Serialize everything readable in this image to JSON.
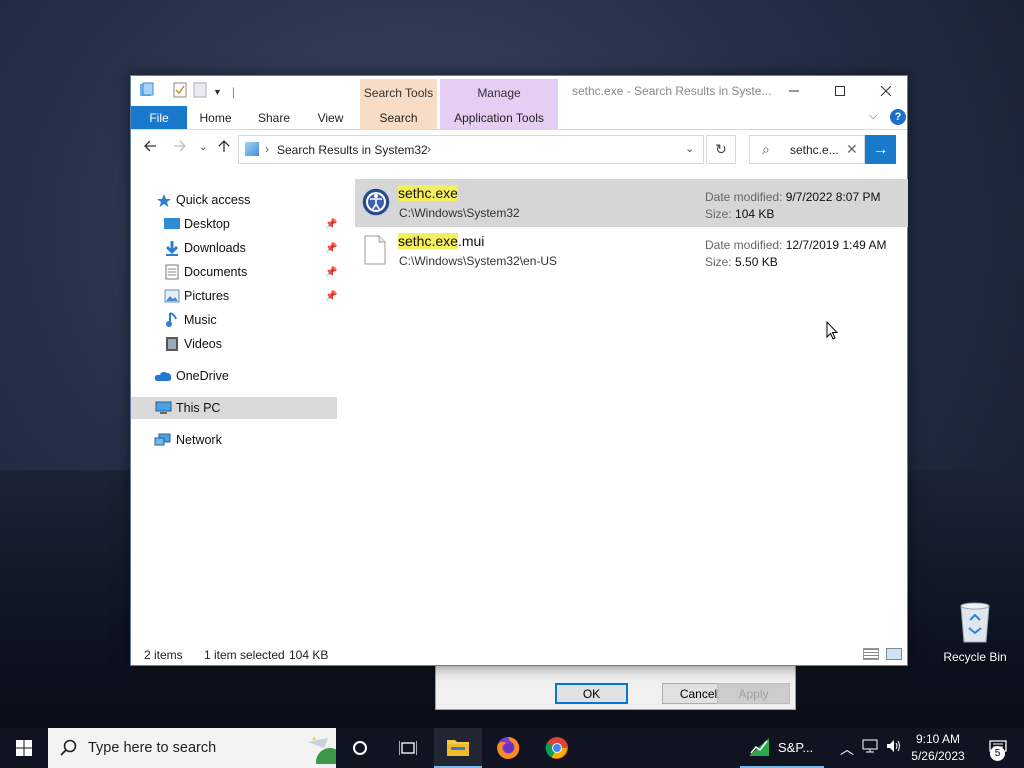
{
  "window": {
    "title": "sethc.exe - Search Results in Syste...",
    "qat_separator": "|",
    "contextual": {
      "search_tools": "Search Tools",
      "manage": "Manage"
    },
    "tabs": {
      "file": "File",
      "home": "Home",
      "share": "Share",
      "view": "View",
      "search": "Search",
      "app_tools": "Application Tools"
    },
    "help": "?"
  },
  "address": {
    "path": "Search Results in System32",
    "separator": "›"
  },
  "search": {
    "query": "sethc.e..."
  },
  "nav": {
    "items": [
      {
        "label": "Quick access",
        "icon": "star-icon"
      },
      {
        "label": "Desktop",
        "icon": "desktop-icon",
        "pinned": true
      },
      {
        "label": "Downloads",
        "icon": "download-icon",
        "pinned": true
      },
      {
        "label": "Documents",
        "icon": "documents-icon",
        "pinned": true
      },
      {
        "label": "Pictures",
        "icon": "pictures-icon",
        "pinned": true
      },
      {
        "label": "Music",
        "icon": "music-icon"
      },
      {
        "label": "Videos",
        "icon": "videos-icon"
      },
      {
        "label": "OneDrive",
        "icon": "cloud-icon"
      },
      {
        "label": "This PC",
        "icon": "computer-icon",
        "selected": true
      },
      {
        "label": "Network",
        "icon": "network-icon"
      }
    ]
  },
  "results": [
    {
      "name_highlight": "sethc.exe",
      "name_rest": "",
      "path": "C:\\Windows\\System32",
      "date_label": "Date modified:",
      "date": "9/7/2022 8:07 PM",
      "size_label": "Size:",
      "size": "104 KB",
      "selected": true
    },
    {
      "name_highlight": "sethc.exe",
      "name_rest": ".mui",
      "path": "C:\\Windows\\System32\\en-US",
      "date_label": "Date modified:",
      "date": "12/7/2019 1:49 AM",
      "size_label": "Size:",
      "size": "5.50 KB",
      "selected": false
    }
  ],
  "status": {
    "count": "2 items",
    "selected": "1 item selected",
    "size": "104 KB"
  },
  "dialog": {
    "ok": "OK",
    "cancel": "Cancel",
    "apply": "Apply"
  },
  "desktop": {
    "recycle_bin": "Recycle Bin"
  },
  "taskbar": {
    "search_placeholder": "Type here to search",
    "pinned_app": "S&P...",
    "time": "9:10 AM",
    "date": "5/26/2023",
    "notifications": "5"
  },
  "colors": {
    "accent": "#1979ca",
    "highlight": "#f4ef5a"
  }
}
